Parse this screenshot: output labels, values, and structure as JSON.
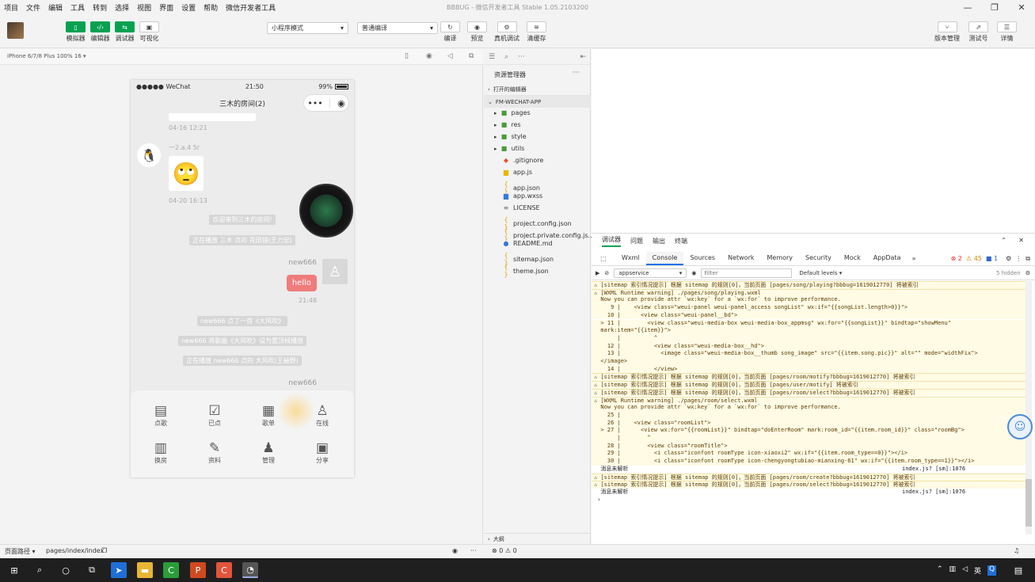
{
  "menubar": {
    "items": [
      "项目",
      "文件",
      "编辑",
      "工具",
      "转到",
      "选择",
      "视图",
      "界面",
      "设置",
      "帮助",
      "微信开发者工具"
    ],
    "window_title": "BBBUG - 微信开发者工具 Stable 1.05.2103200"
  },
  "toolbar": {
    "left_buttons": [
      {
        "label": "模拟器",
        "icon": "phone-icon"
      },
      {
        "label": "编辑器",
        "icon": "code-icon"
      },
      {
        "label": "调试器",
        "icon": "debug-icon"
      },
      {
        "label": "可视化",
        "icon": "layout-icon"
      }
    ],
    "mode_select": "小程序模式",
    "compile_select": "普通编译",
    "center_buttons": [
      "编译",
      "预览",
      "真机调试",
      "清缓存"
    ],
    "right_buttons": [
      "版本管理",
      "测试号",
      "详情"
    ]
  },
  "simulator": {
    "device": "iPhone 6/7/8 Plus 100% 16 ▾",
    "status": {
      "carrier": "●●●●● WeChat",
      "time": "21:50",
      "battery": "99%"
    },
    "nav_title": "三木的房间(2)",
    "times": [
      "04-16 12:21",
      "04-20 16:13",
      "21:48"
    ],
    "user_name": "一2.a.4 5r",
    "system_msgs": [
      "欢迎来到三木的房间!",
      "正在播放 三木 点的 花田错(王力宏)",
      "new666 点了一首《大风吹》",
      "new666 将歌曲《大风吹》设为置顶候播放",
      "正在播放 new666 点的 大风吹(王赫野)"
    ],
    "my_name": "new666",
    "my_msg": "hello",
    "my_name_2": "new666",
    "menu": [
      {
        "label": "点歌",
        "icon": "inbox-icon",
        "glyph": "▤"
      },
      {
        "label": "已点",
        "icon": "checklist-icon",
        "glyph": "☑"
      },
      {
        "label": "歌单",
        "icon": "document-icon",
        "glyph": "▦"
      },
      {
        "label": "在线",
        "icon": "users-icon",
        "glyph": "♙"
      },
      {
        "label": "换房",
        "icon": "building-icon",
        "glyph": "▥"
      },
      {
        "label": "资料",
        "icon": "edit-icon",
        "glyph": "✎"
      },
      {
        "label": "管理",
        "icon": "user-icon",
        "glyph": "♟"
      },
      {
        "label": "分享",
        "icon": "grid-icon",
        "glyph": "▣"
      }
    ]
  },
  "explorer": {
    "title": "资源管理器",
    "open_editors": "打开的编辑器",
    "project": "FM-WECHAT-APP",
    "files": [
      {
        "name": "pages",
        "type": "folder"
      },
      {
        "name": "res",
        "type": "folder"
      },
      {
        "name": "style",
        "type": "folder"
      },
      {
        "name": "utils",
        "type": "folder"
      },
      {
        "name": ".gitignore",
        "type": "git"
      },
      {
        "name": "app.js",
        "type": "js"
      },
      {
        "name": "app.json",
        "type": "json"
      },
      {
        "name": "app.wxss",
        "type": "css"
      },
      {
        "name": "LICENSE",
        "type": "text"
      },
      {
        "name": "project.config.json",
        "type": "json"
      },
      {
        "name": "project.private.config.js...",
        "type": "json"
      },
      {
        "name": "README.md",
        "type": "info"
      },
      {
        "name": "sitemap.json",
        "type": "json"
      },
      {
        "name": "theme.json",
        "type": "json"
      }
    ],
    "outline": "大纲"
  },
  "devtools": {
    "top_tabs": [
      "调试器",
      "问题",
      "输出",
      "终端"
    ],
    "tabs": [
      "Wxml",
      "Console",
      "Sources",
      "Network",
      "Memory",
      "Security",
      "Mock",
      "AppData"
    ],
    "active_tab": "Console",
    "counts": {
      "errors": "2",
      "warnings": "45",
      "info": "1"
    },
    "context": "appservice",
    "filter_placeholder": "Filter",
    "levels": "Default levels ▾",
    "hidden": "5 hidden",
    "lines": [
      {
        "t": "warn",
        "text": "⚠ [sitemap 索引情况提示] 根据 sitemap 的规则[0]，当前页面 [pages/song/playing?bbbug=1619012770] 将被索引"
      },
      {
        "t": "warn",
        "text": "⚠ [WXML Runtime warning] ./pages/song/playing.wxml"
      },
      {
        "t": "warn",
        "text": "  Now you can provide attr `wx:key` for a `wx:for` to improve performance."
      },
      {
        "t": "warn",
        "text": "     9 |    <view class=\"weui-panel weui-panel_access songList\" wx:if=\"{{songList.length>0}}\">"
      },
      {
        "t": "warn",
        "text": "    10 |      <view class=\"weui-panel__bd\">"
      },
      {
        "t": "warn",
        "text": "  > 11 |        <view class=\"weui-media-box weui-media-box_appmsg\" wx:for=\"{{songList}}\" bindtap=\"showMenu\""
      },
      {
        "t": "warn",
        "text": "  mark:item=\"{{item}}\">"
      },
      {
        "t": "warn",
        "text": "       |          ^"
      },
      {
        "t": "warn",
        "text": "    12 |          <view class=\"weui-media-box__hd\">"
      },
      {
        "t": "warn",
        "text": "    13 |            <image class=\"weui-media-box__thumb song_image\" src=\"{{item.song.pic}}\" alt=\"\" mode=\"widthFix\">"
      },
      {
        "t": "warn",
        "text": "  </image>"
      },
      {
        "t": "warn",
        "text": "    14 |          </view>"
      },
      {
        "t": "warn",
        "text": "⚠ [sitemap 索引情况提示] 根据 sitemap 的规则[0]，当前页面 [pages/room/motify?bbbug=1619012770] 将被索引"
      },
      {
        "t": "warn",
        "text": "⚠ [sitemap 索引情况提示] 根据 sitemap 的规则[0]，当前页面 [pages/user/motify] 将被索引"
      },
      {
        "t": "warn",
        "text": "⚠ [sitemap 索引情况提示] 根据 sitemap 的规则[0]，当前页面 [pages/room/select?bbbug=1619012770] 将被索引"
      },
      {
        "t": "warn",
        "text": "⚠ [WXML Runtime warning] ./pages/room/select.wxml"
      },
      {
        "t": "warn",
        "text": "  Now you can provide attr `wx:key` for a `wx:for` to improve performance."
      },
      {
        "t": "warn",
        "text": "    25 |"
      },
      {
        "t": "warn",
        "text": "    26 |    <view class=\"roomList\">"
      },
      {
        "t": "warn",
        "text": "  > 27 |      <view wx:for=\"{{roomList}}\" bindtap=\"doEnterRoom\" mark:room_id=\"{{item.room_id}}\" class=\"roomBg\">"
      },
      {
        "t": "warn",
        "text": "       |        ^"
      },
      {
        "t": "warn",
        "text": "    28 |        <view class=\"roomTitle\">"
      },
      {
        "t": "warn",
        "text": "    29 |          <i class=\"iconfont roomType icon-xiaoxi2\" wx:if=\"{{item.room_type==0}}\"></i>"
      },
      {
        "t": "warn",
        "text": "    30 |          <i class=\"iconfont roomType icon-chengyongtubiao-mianxing-61\" wx:if=\"{{item.room_type==1}}\"></i>"
      },
      {
        "t": "info",
        "text": "  消息未解析                                                                                  index.js? [sm]:1076"
      },
      {
        "t": "warn",
        "text": "⚠ [sitemap 索引情况提示] 根据 sitemap 的规则[0]，当前页面 [pages/room/create?bbbug=1619012770] 将被索引"
      },
      {
        "t": "warn",
        "text": "⚠ [sitemap 索引情况提示] 根据 sitemap 的规则[0]，当前页面 [pages/room/select?bbbug=1619012770] 将被索引"
      },
      {
        "t": "info",
        "text": "  消息未解析                                                                                  index.js? [sm]:1076"
      },
      {
        "t": "info",
        "text": " ›"
      }
    ]
  },
  "statusbar": {
    "path_label": "页面路径 ▾",
    "path": "pages/index/index",
    "problems": "⊗ 0 ⚠ 0"
  },
  "colors": {
    "accent": "#07a150",
    "hello_bubble": "#f07c7c",
    "warn_bg": "#fffbe5"
  }
}
